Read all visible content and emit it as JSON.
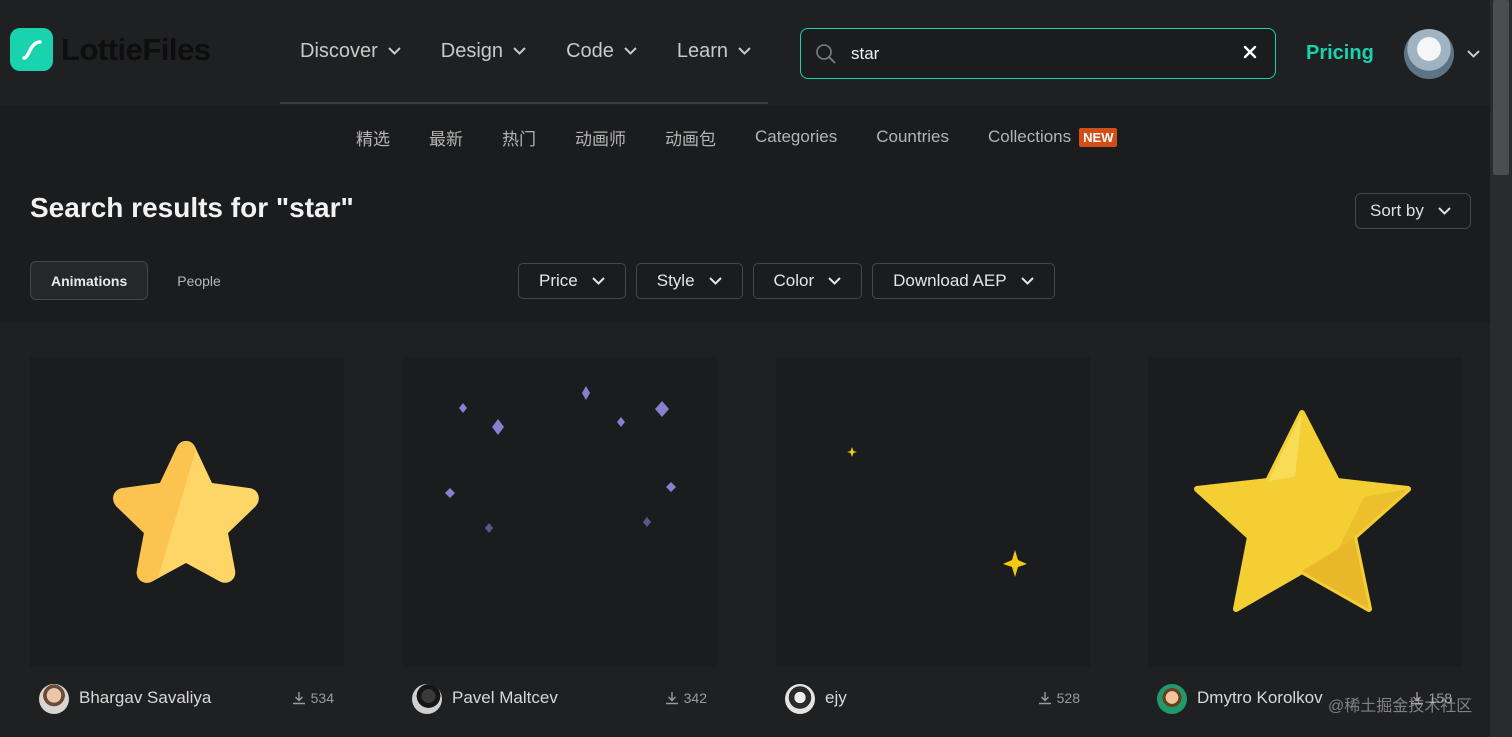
{
  "brand": {
    "name": "LottieFiles",
    "accent": "#19d3ae"
  },
  "nav": {
    "items": [
      {
        "label": "Discover"
      },
      {
        "label": "Design"
      },
      {
        "label": "Code"
      },
      {
        "label": "Learn"
      }
    ],
    "pricing_label": "Pricing"
  },
  "search": {
    "value": "star"
  },
  "subnav": {
    "items": [
      {
        "label": "精选"
      },
      {
        "label": "最新"
      },
      {
        "label": "热门"
      },
      {
        "label": "动画师"
      },
      {
        "label": "动画包"
      },
      {
        "label": "Categories"
      },
      {
        "label": "Countries"
      },
      {
        "label": "Collections"
      }
    ],
    "new_badge": "NEW",
    "new_badge_color": "#d14e16"
  },
  "results": {
    "title": "Search results for \"star\"",
    "sort_label": "Sort by",
    "tabs": [
      {
        "label": "Animations"
      },
      {
        "label": "People"
      }
    ],
    "filters": [
      {
        "label": "Price"
      },
      {
        "label": "Style"
      },
      {
        "label": "Color"
      },
      {
        "label": "Download AEP"
      }
    ],
    "cards": [
      {
        "author": "Bhargav Savaliya",
        "downloads": "534"
      },
      {
        "author": "Pavel Maltcev",
        "downloads": "342"
      },
      {
        "author": "ejy",
        "downloads": "528"
      },
      {
        "author": "Dmytro Korolkov",
        "downloads": "158"
      }
    ]
  },
  "watermark": "@稀土掘金技术社区"
}
